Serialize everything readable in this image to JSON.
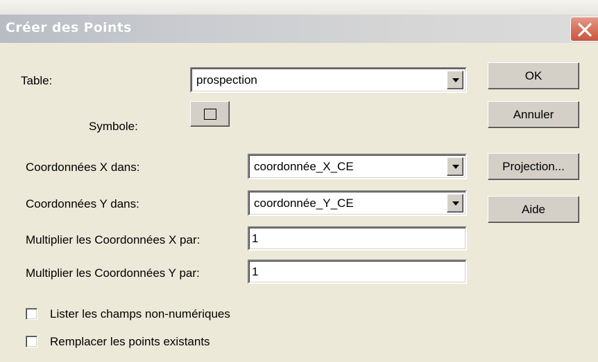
{
  "window": {
    "title": "Créer des Points"
  },
  "form": {
    "table_label": "Table:",
    "table_value": "prospection",
    "symbol_label": "Symbole:",
    "x_coord_label": "Coordonnées X dans:",
    "x_coord_value": "coordonnée_X_CE",
    "y_coord_label": "Coordonnées Y dans:",
    "y_coord_value": "coordonnée_Y_CE",
    "multiply_x_label": "Multiplier les Coordonnées X par:",
    "multiply_x_value": "1",
    "multiply_y_label": "Multiplier les Coordonnées Y par:",
    "multiply_y_value": "1",
    "list_nonnumeric_label": "Lister les champs non-numériques",
    "list_nonnumeric_checked": false,
    "replace_points_label": "Remplacer les points existants",
    "replace_points_checked": false
  },
  "buttons": {
    "ok": "OK",
    "cancel": "Annuler",
    "projection": "Projection...",
    "help": "Aide"
  },
  "icons": {
    "close": "close-icon",
    "dropdown": "dropdown-arrow-icon",
    "symbol": "square-symbol-icon"
  },
  "colors": {
    "dialog_background": "#ece9d8",
    "close_button": "#d7735c",
    "button_face": "#d4d0c8"
  }
}
